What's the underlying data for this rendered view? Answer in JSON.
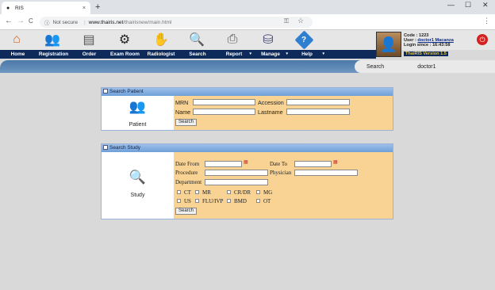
{
  "browser": {
    "tab_title": "RIS",
    "tab_close": "×",
    "new_tab": "+",
    "win_min": "—",
    "win_max": "☐",
    "win_close": "✕",
    "nav_back": "←",
    "nav_fwd": "→",
    "nav_reload": "C",
    "not_secure": "Not secure",
    "url_host": "www.thairis.net",
    "url_path": "/thairisnew/main.html",
    "kebab": "⋮"
  },
  "toolbar": {
    "icons": [
      "home-icon",
      "registration-icon",
      "order-icon",
      "exam-room-icon",
      "radiologist-icon",
      "search-icon",
      "report-icon",
      "manage-icon",
      "help-icon"
    ]
  },
  "menu": {
    "items": [
      {
        "label": "Home",
        "dropdown": false
      },
      {
        "label": "Registration",
        "dropdown": false
      },
      {
        "label": "Order",
        "dropdown": false
      },
      {
        "label": "Exam Room",
        "dropdown": false
      },
      {
        "label": "Radiologist",
        "dropdown": false
      },
      {
        "label": "Search",
        "dropdown": false
      },
      {
        "label": "Report",
        "dropdown": true
      },
      {
        "label": "Manage",
        "dropdown": true
      },
      {
        "label": "Help",
        "dropdown": true
      }
    ],
    "dropdown_glyph": "▾"
  },
  "user": {
    "code_label": "Code : ",
    "code": "1223",
    "user_label": "User : ",
    "user": "doctor1 Macanza",
    "login_label": "Login since : ",
    "login_time": "16:43:58",
    "version": "ThaiRIS Version 1.5"
  },
  "subbar": {
    "page": "Search",
    "username": "doctor1"
  },
  "search_patient": {
    "header": "Search Patient",
    "side_label": "Patient",
    "mrn_label": "MRN",
    "accession_label": "Accession",
    "name_label": "Name",
    "lastname_label": "Lastname",
    "search_button": "Search"
  },
  "search_study": {
    "header": "Search Study",
    "side_label": "Study",
    "date_from_label": "Date From",
    "date_to_label": "Date To",
    "procedure_label": "Procedure",
    "physician_label": "Physician",
    "department_label": "Department",
    "modalities": [
      "CT",
      "MR",
      "CR/DR",
      "MG",
      "US",
      "FLU/IVP",
      "BMD",
      "OT"
    ],
    "search_button": "Search"
  },
  "colors": {
    "nav_blue": "#0d2a5a",
    "form_bg": "#f8d394",
    "panel_header": "#6f9fd8",
    "version_text": "#e7c23a"
  }
}
